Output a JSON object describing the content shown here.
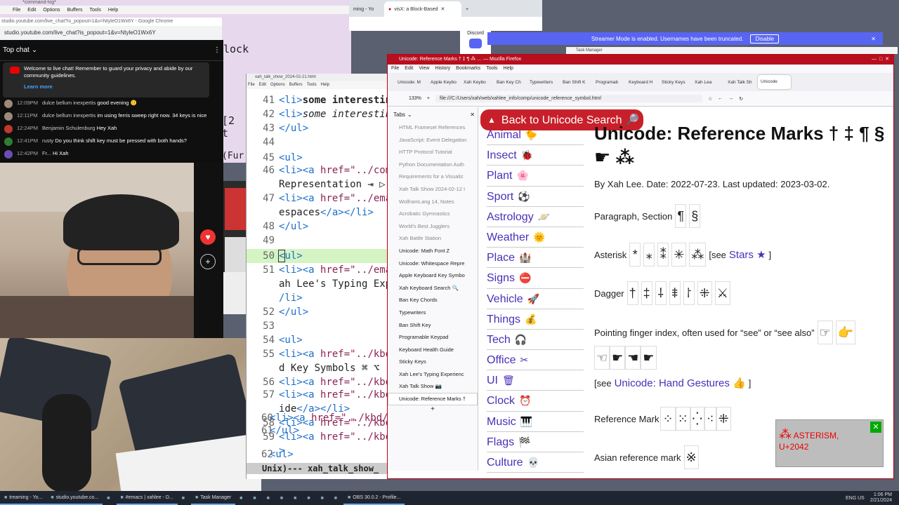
{
  "emacs_bg": {
    "title": "*command-log*",
    "menu": [
      "File",
      "Edit",
      "Options",
      "Buffers",
      "Tools",
      "Help"
    ],
    "text1": "lock",
    "text2": "[2 t",
    "text3": "(Fur"
  },
  "chrome": {
    "tabs": [
      "ming - Yo",
      "visX: a Block-Based"
    ],
    "discord_label": "Discord"
  },
  "livechat": {
    "window_title": "studio.youtube.com/live_chat?is_popout=1&v=NtyleO1Wx6Y - Google Chrome",
    "url": "studio.youtube.com/live_chat?is_popout=1&v=NtyleO1Wx6Y",
    "header": "Top chat",
    "welcome": "Welcome to live chat! Remember to guard your privacy and abide by our community guidelines.",
    "learn_more": "Learn more",
    "messages": [
      {
        "time": "12:09PM",
        "name": "dulce bellum inexpertis",
        "text": "good evening 🙂",
        "avatar": "#9c8a7a"
      },
      {
        "time": "12:11PM",
        "name": "dulce bellum inexpertis",
        "text": "im using ferris sweep right now. 34 keys is nice",
        "avatar": "#9c8a7a"
      },
      {
        "time": "12:24PM",
        "name": "Benjamin Schulenburg",
        "text": "Hey Xah",
        "avatar": "#c0392b"
      },
      {
        "time": "12:41PM",
        "name": "rusty",
        "text": "Do you think shift key must be pressed with both hands?",
        "avatar": "#2e7d32"
      },
      {
        "time": "12:42PM",
        "name": "Fr...",
        "text": "Hi Xah",
        "avatar": "#6a4fb3"
      }
    ]
  },
  "emacs": {
    "title": "xah_talk_show_2024-02-21.html",
    "menu": [
      "File",
      "Edit",
      "Options",
      "Buffers",
      "Tools",
      "Help"
    ],
    "modeline": "Unix)--- xah_talk_show_"
  },
  "firefox": {
    "title": "Unicode: Reference Marks † ‡ ¶ ⁂ … — Mozilla Firefox",
    "menu": [
      "File",
      "Edit",
      "View",
      "History",
      "Bookmarks",
      "Tools",
      "Help"
    ],
    "tabs": [
      "Unicode: M",
      "Apple Keybo",
      "Xah Keybo",
      "Ban Key Ch",
      "Typewriters",
      "Ban Shift K",
      "Programab",
      "Keyboard H",
      "Sticky Keys",
      "Xah Lea",
      "Xah Talk Sh",
      "Unicode"
    ],
    "zoom": "133%",
    "url": "file:///C:/Users/xah/web/xahlee_info/comp/unicode_reference_symbol.html",
    "sidebar_header": "Tabs",
    "sidebar_tabs": [
      {
        "label": "HTML Frameset References",
        "state": "unloaded"
      },
      {
        "label": "JavaScript: Event Delegation",
        "state": "unloaded"
      },
      {
        "label": "HTTP Protocol Tutorial",
        "state": "unloaded"
      },
      {
        "label": "Python Documentation Auth",
        "state": "unloaded"
      },
      {
        "label": "Requirements for a Visualiz",
        "state": "unloaded"
      },
      {
        "label": "Xah Talk Show 2024-02-12 I",
        "state": "unloaded"
      },
      {
        "label": "WolframLang 14, Notes",
        "state": "unloaded"
      },
      {
        "label": "Acrobatic Gymnastics",
        "state": "unloaded"
      },
      {
        "label": "World's Best Jugglers",
        "state": "unloaded"
      },
      {
        "label": "Xah Battle Station",
        "state": "unloaded"
      },
      {
        "label": "Unicode: Math Font Z",
        "state": "loaded"
      },
      {
        "label": "Unicode: Whitespace Repre",
        "state": "loaded"
      },
      {
        "label": "Apple Keyboard Key Symbo",
        "state": "loaded"
      },
      {
        "label": "Xah Keyboard Search 🔍",
        "state": "loaded"
      },
      {
        "label": "Ban Key Chords",
        "state": "loaded"
      },
      {
        "label": "Typewriters",
        "state": "loaded"
      },
      {
        "label": "Ban Shift Key",
        "state": "loaded"
      },
      {
        "label": "Programable Keypad",
        "state": "loaded"
      },
      {
        "label": "Keyboard Health Guide",
        "state": "loaded"
      },
      {
        "label": "Sticky Keys",
        "state": "loaded"
      },
      {
        "label": "Xah Lee's Typing Experienc",
        "state": "loaded"
      },
      {
        "label": "Xah Talk Show 📷",
        "state": "loaded"
      },
      {
        "label": "Unicode: Reference Marks †",
        "state": "active"
      }
    ],
    "back_button": "Back to Unicode Search 🔎",
    "categories": [
      {
        "label": "Animal",
        "icon": "🐤"
      },
      {
        "label": "Insect",
        "icon": "🐞"
      },
      {
        "label": "Plant",
        "icon": "🌸"
      },
      {
        "label": "Sport",
        "icon": "⚽"
      },
      {
        "label": "Astrology",
        "icon": "🪐"
      },
      {
        "label": "Weather",
        "icon": "🌞"
      },
      {
        "label": "Place",
        "icon": "🏰"
      },
      {
        "label": "Signs",
        "icon": "⛔"
      },
      {
        "label": "Vehicle",
        "icon": "🚀"
      },
      {
        "label": "Things",
        "icon": "💰"
      },
      {
        "label": "Tech",
        "icon": "🎧"
      },
      {
        "label": "Office",
        "icon": "✂"
      },
      {
        "label": "UI",
        "icon": "🗑"
      },
      {
        "label": "Clock",
        "icon": "⏰"
      },
      {
        "label": "Music",
        "icon": "🎹"
      },
      {
        "label": "Flags",
        "icon": "🏁"
      },
      {
        "label": "Culture",
        "icon": "💀"
      }
    ],
    "page": {
      "title": "Unicode: Reference Marks † ‡ ¶ § ☛ ⁂",
      "byline": "By Xah Lee. Date: 2022-07-23. Last updated: 2023-03-02.",
      "paragraph_label": "Paragraph, Section",
      "paragraph_glyphs": [
        "¶",
        "§"
      ],
      "asterisk_label": "Asterisk",
      "asterisk_glyphs": [
        "*",
        "⁎",
        "⁑",
        "✳",
        "⁂"
      ],
      "asterisk_see": "[see",
      "asterisk_link": "Stars ★",
      "asterisk_close": "]",
      "dagger_label": "Dagger",
      "dagger_glyphs": [
        "†",
        "‡",
        "⸸",
        "⹋",
        "⸷",
        "⁜",
        "⚔"
      ],
      "pointing_label": "Pointing finger index, often used for “see” or “see also”",
      "pointing_glyphs": [
        "☞",
        "👉"
      ],
      "pointing_glyphs2": [
        "☜",
        "☛",
        "☚",
        "☛"
      ],
      "hand_see": "[see",
      "hand_link": "Unicode: Hand Gestures 👍",
      "hand_close": "]",
      "refmark_label": "Reference Mark",
      "refmark_glyphs": [
        "⁘",
        "⁙",
        "⁛",
        "⁖",
        "⁜"
      ],
      "asian_label": "Asian reference mark",
      "asian_glyphs": [
        "※"
      ]
    }
  },
  "streamer_mode": {
    "text": "Streamer Mode is enabled. Usernames have been truncated.",
    "button": "Disable"
  },
  "task_manager": "Task Manager",
  "tooltip": {
    "glyph": "⁂",
    "text": "ASTERISM,",
    "code": "U+2042"
  },
  "taskbar": {
    "items": [
      "treaming - Yo...",
      "studio.youtube.co...",
      "",
      "#emacs | xahlee - D...",
      "",
      "Task Manager",
      "",
      "",
      "",
      "",
      "",
      "",
      "",
      "",
      "OBS 30.0.2 - Profile..."
    ],
    "time": "1:06 PM",
    "date": "2/21/2024",
    "lang": "ENG US"
  }
}
